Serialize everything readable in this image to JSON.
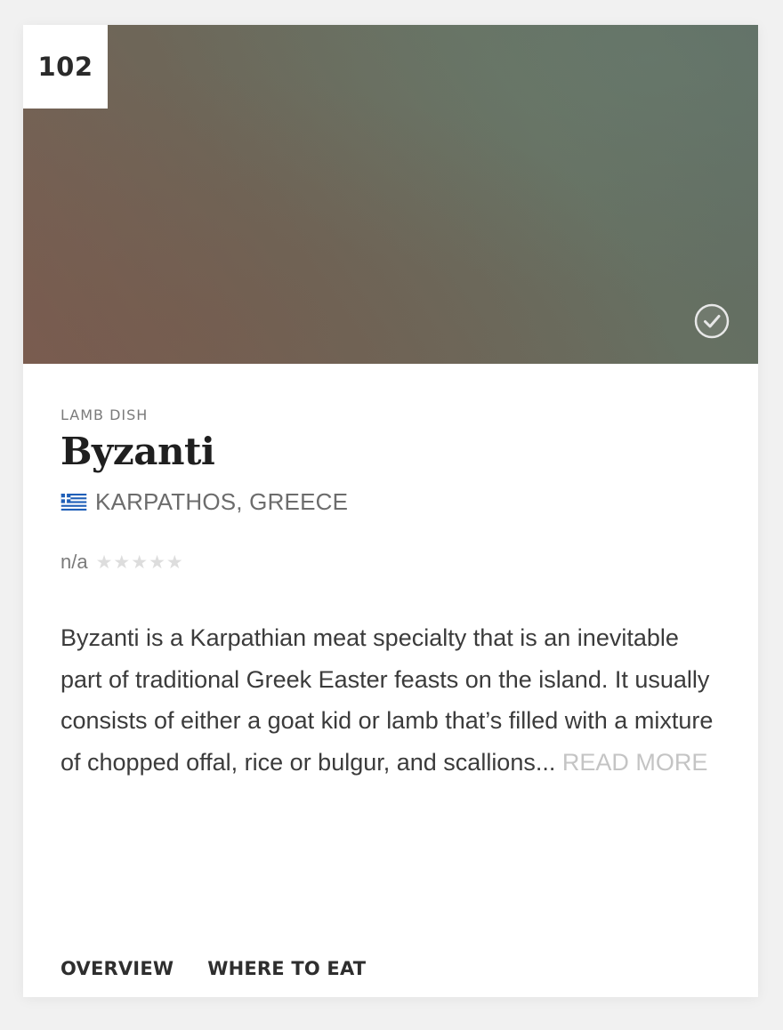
{
  "card": {
    "rank": "102",
    "image": {
      "status_icon": "check-circle-icon"
    },
    "dish_type": "LAMB DISH",
    "dish_name": "Byzanti",
    "origin": {
      "flag_icon": "greece-flag-icon",
      "text": "KARPATHOS, GREECE"
    },
    "rating": {
      "text": "n/a",
      "max_stars": 5,
      "filled_stars": 0,
      "star_color": "#dddddd"
    },
    "description": {
      "text": "Byzanti is a Karpathian meat specialty that is an inevitable part of traditional Greek Easter feasts on the island. It usually consists of either a goat kid or lamb that’s filled with a mixture of chopped offal, rice or bulgur, and scallions...",
      "read_more_label": "READ MORE"
    },
    "tabs": [
      {
        "label": "OVERVIEW"
      },
      {
        "label": "WHERE TO EAT"
      }
    ]
  },
  "colors": {
    "background": "#f1f1f1",
    "card": "#ffffff",
    "flag_blue": "#1f5fb8",
    "read_more": "#c4c4c4"
  }
}
